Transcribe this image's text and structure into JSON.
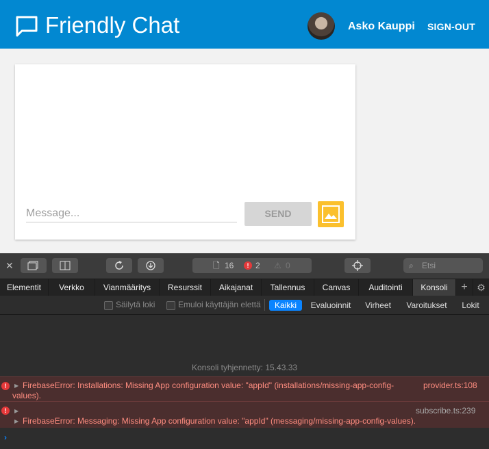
{
  "header": {
    "title": "Friendly Chat",
    "user_name": "Asko Kauppi",
    "sign_out": "SIGN-OUT",
    "brand_color": "#0288d1"
  },
  "chat": {
    "message_placeholder": "Message...",
    "message_value": "",
    "send_label": "SEND",
    "image_button_color": "#fbc02d"
  },
  "devtools": {
    "counts": {
      "files": "16",
      "errors": "2",
      "warnings": "0"
    },
    "search_placeholder": "Etsi",
    "tabs": [
      "Elementit",
      "Verkko",
      "Vianmääritys",
      "Resurssit",
      "Aikajanat",
      "Tallennus",
      "Canvas",
      "Auditointi",
      "Konsoli"
    ],
    "active_tab": "Konsoli",
    "filters": {
      "preserve_log": "Säilytä loki",
      "emulate_user": "Emuloi käyttäjän elettä",
      "levels": [
        "Kaikki",
        "Evaluoinnit",
        "Virheet",
        "Varoitukset",
        "Lokit"
      ],
      "active_level": "Kaikki"
    },
    "console": {
      "cleared": "Konsoli tyhjennetty: 15.43.33",
      "error1_line1": "FirebaseError: Installations: Missing App configuration value: \"appId\" (installations/missing-app-config-",
      "error1_line2": "values).",
      "error1_source": "provider.ts:108",
      "error2_source": "subscribe.ts:239",
      "error2_text": "FirebaseError: Messaging: Missing App configuration value: \"appId\" (messaging/missing-app-config-values)."
    },
    "prompt_symbol": "›"
  }
}
